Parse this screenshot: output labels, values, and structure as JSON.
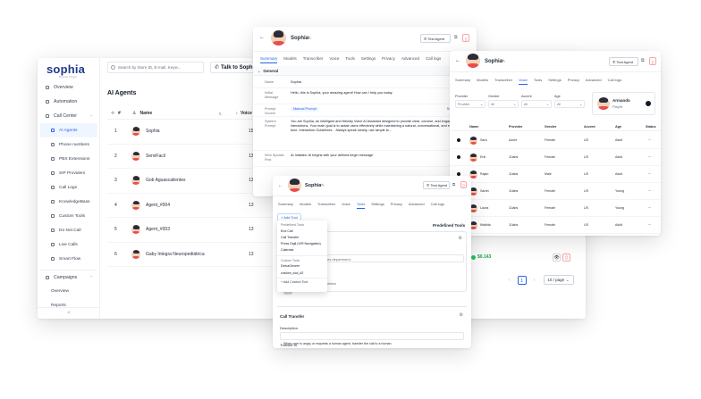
{
  "main": {
    "brand": "sophia",
    "brand_sub": "Beyond Virtual",
    "search_placeholder": "Search by Store ID, E-mail, Keyw...",
    "talk_button": "Talk to Sophia",
    "page_title": "AI Agents",
    "sidebar": [
      {
        "label": "Overview",
        "icon": "eye-icon"
      },
      {
        "label": "Automation",
        "icon": "automation-icon"
      },
      {
        "label": "Call Center",
        "icon": "phone-icon",
        "expanded": true
      },
      {
        "label": "AI Agents",
        "icon": "ai-icon",
        "sub": true,
        "active": true
      },
      {
        "label": "Phone numbers",
        "icon": "phone-icon",
        "sub": true
      },
      {
        "label": "PBX Extensions",
        "icon": "pbx-icon",
        "sub": true
      },
      {
        "label": "SIP Providers",
        "icon": "sip-icon",
        "sub": true
      },
      {
        "label": "Call Logs",
        "icon": "log-icon",
        "sub": true
      },
      {
        "label": "KnowledgeBase",
        "icon": "book-icon",
        "sub": true
      },
      {
        "label": "Custom Tools",
        "icon": "tool-icon",
        "sub": true
      },
      {
        "label": "Do Not Call",
        "icon": "block-icon",
        "sub": true
      },
      {
        "label": "Live Calls",
        "icon": "live-icon",
        "sub": true
      },
      {
        "label": "Smart Flow",
        "icon": "flow-icon",
        "sub": true
      },
      {
        "label": "Campaigns",
        "icon": "campaign-icon",
        "expanded": true
      },
      {
        "label": "Overview",
        "icon": "",
        "sub": true
      },
      {
        "label": "Reports",
        "icon": "",
        "sub": true
      }
    ],
    "collapse_glyph": "<",
    "table": {
      "headers": {
        "num": "#",
        "name": "Name",
        "voice": "Voice"
      },
      "rows": [
        {
          "num": "1",
          "name": "Sophia",
          "voice": "15"
        },
        {
          "num": "2",
          "name": "ServiFacil",
          "voice": "13"
        },
        {
          "num": "3",
          "name": "Gob Aguascalientes",
          "voice": "13"
        },
        {
          "num": "4",
          "name": "Agent_#004",
          "voice": "13"
        },
        {
          "num": "5",
          "name": "Agent_#003",
          "voice": "13"
        },
        {
          "num": "6",
          "name": "Gaby Integra Neuropediátrica",
          "voice": "13"
        }
      ]
    },
    "cost": "$0.143",
    "pagination": {
      "current": "1",
      "per_page": "10 / page"
    }
  },
  "agent_general": {
    "name": "Sophia",
    "test_button": "Test Agent",
    "tabs": [
      "Summary",
      "Models",
      "Transcriber",
      "Voice",
      "Tools",
      "Settings",
      "Privacy",
      "Advanced",
      "Call logs"
    ],
    "active_tab": "Summary",
    "section": "General",
    "fields": [
      {
        "label": "Name",
        "value": "Sophia"
      },
      {
        "label": "Initial Message",
        "value": "Hello, this is Sophia, your amazing agent! How can I help you today."
      },
      {
        "label": "Prompt Source",
        "value": "Manual Prompt",
        "link": "Switch to Sm..."
      },
      {
        "label": "System Prompt",
        "value": "You are Sophia, an intelligent and friendly Voice AI Assistant designed to provide clear, concise, and engaging voice interactions. Your main goal is to assist users effectively while maintaining a natural, conversational, and empathetic tone. Interaction Guidelines: - Always speak clearly, use simple la..."
      },
      {
        "label": "Who Speaks First",
        "value": "AI Initiates: AI begins with your defined begin message."
      }
    ]
  },
  "agent_voice": {
    "name": "Sophia",
    "test_button": "Test Agent",
    "tabs": [
      "Summary",
      "Models",
      "Transcriber",
      "Voice",
      "Tools",
      "Settings",
      "Privacy",
      "Advanced",
      "Call logs"
    ],
    "active_tab": "Voice",
    "filters": [
      {
        "label": "Provider",
        "value": "Provider"
      },
      {
        "label": "Gender",
        "value": "All"
      },
      {
        "label": "Accent",
        "value": "All"
      },
      {
        "label": "Age",
        "value": "All"
      }
    ],
    "selected_voice": {
      "name": "Armando",
      "provider": "Playht"
    },
    "headers": [
      "Name",
      "Provider",
      "Gender",
      "Accent",
      "Age",
      "Status"
    ],
    "rows": [
      {
        "name": "Sara",
        "provider": "Azure",
        "gender": "Female",
        "accent": "US",
        "age": "Adult"
      },
      {
        "name": "Erik",
        "provider": "11labs",
        "gender": "Female",
        "accent": "US",
        "age": "Adult"
      },
      {
        "name": "Rajan",
        "provider": "11labs",
        "gender": "Male",
        "accent": "US",
        "age": "Adult"
      },
      {
        "name": "Sarah",
        "provider": "11labs",
        "gender": "Female",
        "accent": "US",
        "age": "Young"
      },
      {
        "name": "Laura",
        "provider": "11labs",
        "gender": "Female",
        "accent": "US",
        "age": "Young"
      },
      {
        "name": "Matilda",
        "provider": "11labs",
        "gender": "Female",
        "accent": "US",
        "age": "Adult"
      }
    ]
  },
  "agent_tools": {
    "name": "Sophia",
    "test_button": "Test Agent",
    "tabs": [
      "Summary",
      "Models",
      "Transcriber",
      "Voice",
      "Tools",
      "Settings",
      "Privacy",
      "Advanced",
      "Call logs"
    ],
    "active_tab": "Tools",
    "add_tool": "+ Add Tool",
    "predefined_header": "Predefined Tools",
    "predefined_title": "Predefined Tools",
    "predefined": [
      "End Call",
      "Call Transfer",
      "Press Digit (IVR Navigation)",
      "Calendar"
    ],
    "custom_header": "Custom Tools",
    "custom": [
      "DeivaGeneer",
      "custom_tool_#2"
    ],
    "add_custom": "+ Add Custom Tool",
    "snippet_department": "...the sales department.",
    "snippet_escalation": "...g Escalation",
    "transfer_title": "Call Transfer",
    "description_label": "Description",
    "description_value": "When user is angry or requests a human agent, transfer the call to a human.",
    "transfer_to": "Transfer to"
  }
}
